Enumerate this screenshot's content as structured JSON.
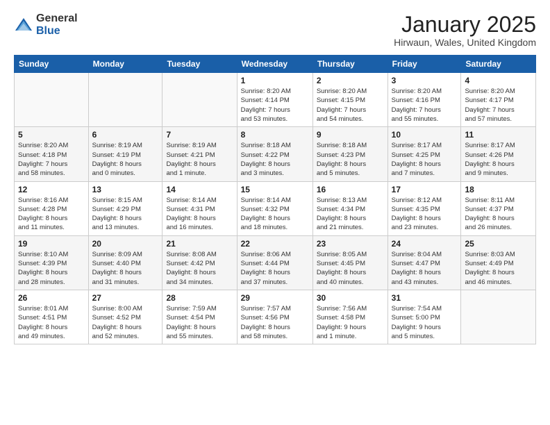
{
  "logo": {
    "general": "General",
    "blue": "Blue"
  },
  "calendar": {
    "title": "January 2025",
    "subtitle": "Hirwaun, Wales, United Kingdom",
    "headers": [
      "Sunday",
      "Monday",
      "Tuesday",
      "Wednesday",
      "Thursday",
      "Friday",
      "Saturday"
    ],
    "weeks": [
      [
        {
          "day": "",
          "info": ""
        },
        {
          "day": "",
          "info": ""
        },
        {
          "day": "",
          "info": ""
        },
        {
          "day": "1",
          "info": "Sunrise: 8:20 AM\nSunset: 4:14 PM\nDaylight: 7 hours\nand 53 minutes."
        },
        {
          "day": "2",
          "info": "Sunrise: 8:20 AM\nSunset: 4:15 PM\nDaylight: 7 hours\nand 54 minutes."
        },
        {
          "day": "3",
          "info": "Sunrise: 8:20 AM\nSunset: 4:16 PM\nDaylight: 7 hours\nand 55 minutes."
        },
        {
          "day": "4",
          "info": "Sunrise: 8:20 AM\nSunset: 4:17 PM\nDaylight: 7 hours\nand 57 minutes."
        }
      ],
      [
        {
          "day": "5",
          "info": "Sunrise: 8:20 AM\nSunset: 4:18 PM\nDaylight: 7 hours\nand 58 minutes."
        },
        {
          "day": "6",
          "info": "Sunrise: 8:19 AM\nSunset: 4:19 PM\nDaylight: 8 hours\nand 0 minutes."
        },
        {
          "day": "7",
          "info": "Sunrise: 8:19 AM\nSunset: 4:21 PM\nDaylight: 8 hours\nand 1 minute."
        },
        {
          "day": "8",
          "info": "Sunrise: 8:18 AM\nSunset: 4:22 PM\nDaylight: 8 hours\nand 3 minutes."
        },
        {
          "day": "9",
          "info": "Sunrise: 8:18 AM\nSunset: 4:23 PM\nDaylight: 8 hours\nand 5 minutes."
        },
        {
          "day": "10",
          "info": "Sunrise: 8:17 AM\nSunset: 4:25 PM\nDaylight: 8 hours\nand 7 minutes."
        },
        {
          "day": "11",
          "info": "Sunrise: 8:17 AM\nSunset: 4:26 PM\nDaylight: 8 hours\nand 9 minutes."
        }
      ],
      [
        {
          "day": "12",
          "info": "Sunrise: 8:16 AM\nSunset: 4:28 PM\nDaylight: 8 hours\nand 11 minutes."
        },
        {
          "day": "13",
          "info": "Sunrise: 8:15 AM\nSunset: 4:29 PM\nDaylight: 8 hours\nand 13 minutes."
        },
        {
          "day": "14",
          "info": "Sunrise: 8:14 AM\nSunset: 4:31 PM\nDaylight: 8 hours\nand 16 minutes."
        },
        {
          "day": "15",
          "info": "Sunrise: 8:14 AM\nSunset: 4:32 PM\nDaylight: 8 hours\nand 18 minutes."
        },
        {
          "day": "16",
          "info": "Sunrise: 8:13 AM\nSunset: 4:34 PM\nDaylight: 8 hours\nand 21 minutes."
        },
        {
          "day": "17",
          "info": "Sunrise: 8:12 AM\nSunset: 4:35 PM\nDaylight: 8 hours\nand 23 minutes."
        },
        {
          "day": "18",
          "info": "Sunrise: 8:11 AM\nSunset: 4:37 PM\nDaylight: 8 hours\nand 26 minutes."
        }
      ],
      [
        {
          "day": "19",
          "info": "Sunrise: 8:10 AM\nSunset: 4:39 PM\nDaylight: 8 hours\nand 28 minutes."
        },
        {
          "day": "20",
          "info": "Sunrise: 8:09 AM\nSunset: 4:40 PM\nDaylight: 8 hours\nand 31 minutes."
        },
        {
          "day": "21",
          "info": "Sunrise: 8:08 AM\nSunset: 4:42 PM\nDaylight: 8 hours\nand 34 minutes."
        },
        {
          "day": "22",
          "info": "Sunrise: 8:06 AM\nSunset: 4:44 PM\nDaylight: 8 hours\nand 37 minutes."
        },
        {
          "day": "23",
          "info": "Sunrise: 8:05 AM\nSunset: 4:45 PM\nDaylight: 8 hours\nand 40 minutes."
        },
        {
          "day": "24",
          "info": "Sunrise: 8:04 AM\nSunset: 4:47 PM\nDaylight: 8 hours\nand 43 minutes."
        },
        {
          "day": "25",
          "info": "Sunrise: 8:03 AM\nSunset: 4:49 PM\nDaylight: 8 hours\nand 46 minutes."
        }
      ],
      [
        {
          "day": "26",
          "info": "Sunrise: 8:01 AM\nSunset: 4:51 PM\nDaylight: 8 hours\nand 49 minutes."
        },
        {
          "day": "27",
          "info": "Sunrise: 8:00 AM\nSunset: 4:52 PM\nDaylight: 8 hours\nand 52 minutes."
        },
        {
          "day": "28",
          "info": "Sunrise: 7:59 AM\nSunset: 4:54 PM\nDaylight: 8 hours\nand 55 minutes."
        },
        {
          "day": "29",
          "info": "Sunrise: 7:57 AM\nSunset: 4:56 PM\nDaylight: 8 hours\nand 58 minutes."
        },
        {
          "day": "30",
          "info": "Sunrise: 7:56 AM\nSunset: 4:58 PM\nDaylight: 9 hours\nand 1 minute."
        },
        {
          "day": "31",
          "info": "Sunrise: 7:54 AM\nSunset: 5:00 PM\nDaylight: 9 hours\nand 5 minutes."
        },
        {
          "day": "",
          "info": ""
        }
      ]
    ]
  }
}
